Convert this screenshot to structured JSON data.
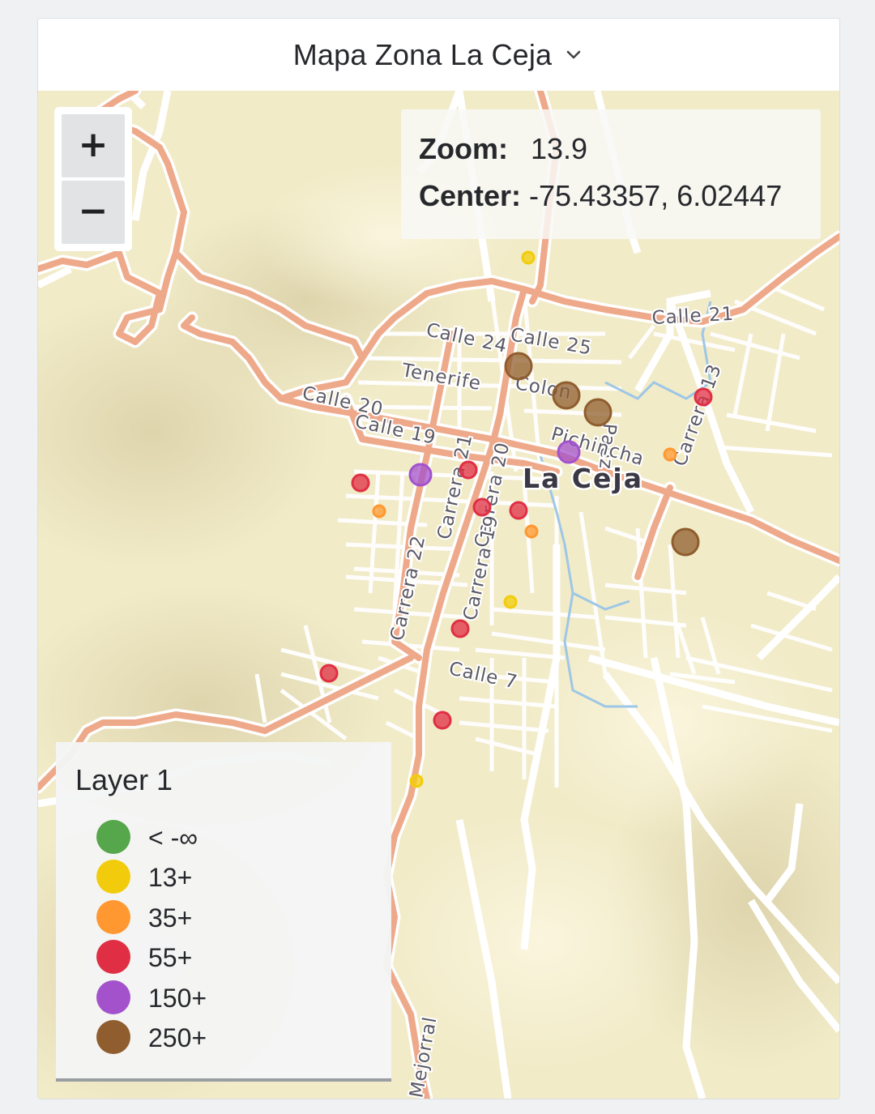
{
  "panel": {
    "title": "Mapa Zona La Ceja",
    "title_icon": "chevron-down-icon"
  },
  "zoom_controls": {
    "in_label": "+",
    "out_label": "−"
  },
  "map_info": {
    "zoom_key": "Zoom:",
    "zoom_value": "13.9",
    "center_key": "Center:",
    "center_value": "-75.43357, 6.02447"
  },
  "map_labels": {
    "city": "La Ceja",
    "streets": [
      "Calle 21",
      "Calle 24",
      "Calle 25",
      "Tenerife",
      "Colon",
      "Paez",
      "Calle 20",
      "Calle 19",
      "Pichincha",
      "Carrera 13",
      "Carrera 21",
      "Carrera 20",
      "Carrera 19",
      "Carrera 22",
      "Calle 7",
      "Mejorral"
    ]
  },
  "legend": {
    "title": "Layer 1",
    "items": [
      {
        "label": "< -∞",
        "color": "#56a64b"
      },
      {
        "label": "13+",
        "color": "#f2cc0c"
      },
      {
        "label": "35+",
        "color": "#ff9830"
      },
      {
        "label": "55+",
        "color": "#e02f44"
      },
      {
        "label": "150+",
        "color": "#a352cc"
      },
      {
        "label": "250+",
        "color": "#8f5d2e"
      }
    ]
  },
  "markers": [
    {
      "level": "13+"
    },
    {
      "level": "250+"
    },
    {
      "level": "250+"
    },
    {
      "level": "250+"
    },
    {
      "level": "55+"
    },
    {
      "level": "150+"
    },
    {
      "level": "35+"
    },
    {
      "level": "150+"
    },
    {
      "level": "55+"
    },
    {
      "level": "55+"
    },
    {
      "level": "35+"
    },
    {
      "level": "55+"
    },
    {
      "level": "55+"
    },
    {
      "level": "35+"
    },
    {
      "level": "250+"
    },
    {
      "level": "13+"
    },
    {
      "level": "55+"
    },
    {
      "level": "55+"
    },
    {
      "level": "55+"
    },
    {
      "level": "13+"
    }
  ]
}
